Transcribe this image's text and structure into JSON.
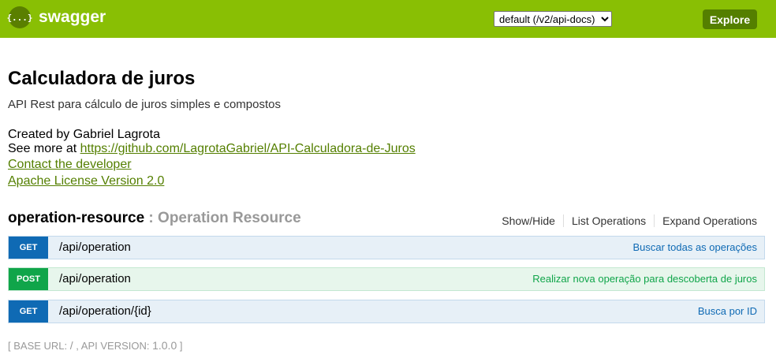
{
  "header": {
    "logo_glyph": "{...}",
    "logo_text": "swagger",
    "spec_select": {
      "selected": "default (/v2/api-docs)",
      "options": [
        "default (/v2/api-docs)"
      ]
    },
    "explore_label": "Explore",
    "colors": {
      "bar": "#89bf04",
      "button": "#547f00"
    }
  },
  "info": {
    "title": "Calculadora de juros",
    "description": "API Rest para cálculo de juros simples e compostos",
    "created_by": "Created by Gabriel Lagrota",
    "see_more_prefix": "See more at ",
    "see_more_link": "https://github.com/LagrotaGabriel/API-Calculadora-de-Juros",
    "contact_link": "Contact the developer",
    "license_link": "Apache License Version 2.0"
  },
  "resource": {
    "name": "operation-resource",
    "separator": " : ",
    "description": "Operation Resource",
    "actions": [
      "Show/Hide",
      "List Operations",
      "Expand Operations"
    ],
    "operations": [
      {
        "method": "GET",
        "path": "/api/operation",
        "summary": "Buscar todas as operações",
        "color": "#0f6ab4"
      },
      {
        "method": "POST",
        "path": "/api/operation",
        "summary": "Realizar nova operação para descoberta de juros",
        "color": "#10a54a"
      },
      {
        "method": "GET",
        "path": "/api/operation/{id}",
        "summary": "Busca por ID",
        "color": "#0f6ab4"
      }
    ]
  },
  "footer": {
    "open": "[ ",
    "base_url_label": "BASE URL: ",
    "base_url": "/",
    "sep": " , ",
    "api_version_label": "API VERSION: ",
    "api_version": "1.0.0",
    "close": " ]"
  }
}
